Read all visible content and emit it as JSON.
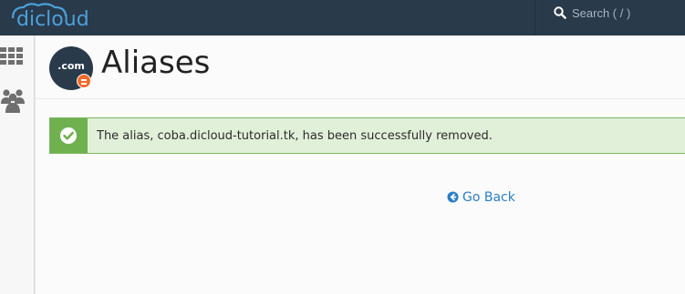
{
  "app": {
    "logo_text": "dicloud",
    "brand_color": "#4ba0dc",
    "topbar_color": "#293a4a"
  },
  "search": {
    "placeholder": "Search ( / )",
    "value": ""
  },
  "sidebar": {
    "items": [
      {
        "icon": "grid-icon"
      },
      {
        "icon": "users-icon"
      }
    ]
  },
  "header": {
    "icon_label": ".com",
    "title": "Aliases"
  },
  "alert": {
    "type": "success",
    "icon": "check-circle-icon",
    "message": "The alias, coba.dicloud-tutorial.tk, has been successfully removed.",
    "color": "#6fb14f"
  },
  "actions": {
    "go_back_label": "Go Back",
    "go_back_icon": "arrow-left-circle-icon"
  }
}
